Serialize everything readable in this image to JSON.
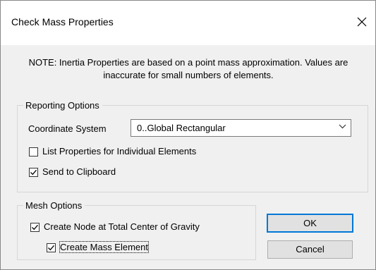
{
  "window": {
    "title": "Check Mass Properties",
    "close_icon": "close-icon"
  },
  "note": "NOTE: Inertia Properties are based on a point mass approximation. Values are inaccurate for small numbers of elements.",
  "reporting": {
    "legend": "Reporting Options",
    "coord_label": "Coordinate System",
    "coord_value": "0..Global Rectangular",
    "list_props_label": "List Properties for Individual Elements",
    "list_props_checked": false,
    "send_clipboard_label": "Send to Clipboard",
    "send_clipboard_checked": true
  },
  "mesh": {
    "legend": "Mesh Options",
    "create_node_label": "Create Node at Total Center of Gravity",
    "create_node_checked": true,
    "create_mass_label": "Create Mass Element",
    "create_mass_checked": true
  },
  "buttons": {
    "ok": "OK",
    "cancel": "Cancel"
  }
}
